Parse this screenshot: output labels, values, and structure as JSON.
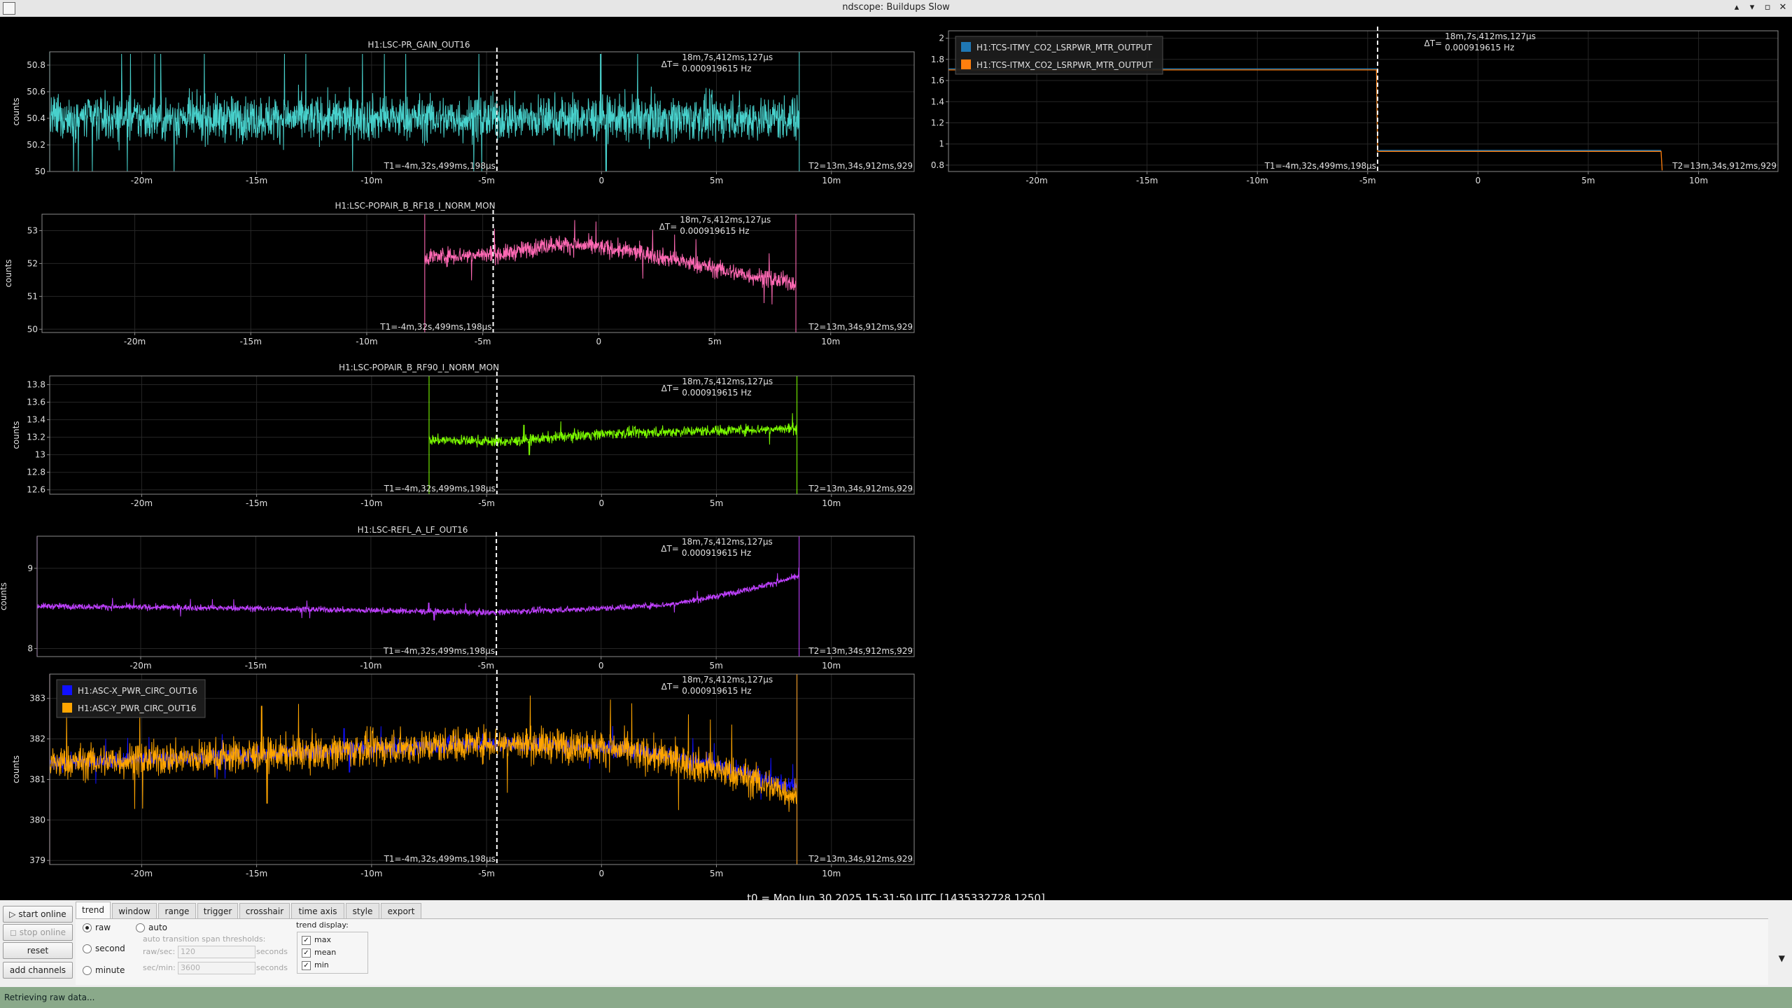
{
  "window": {
    "title": "ndscope: Buildups Slow",
    "minimize": "▴",
    "restore": "▾",
    "maximize": "▫",
    "close": "✕"
  },
  "colors": {
    "background": "#000000",
    "frame": "#8a8a8a",
    "grid": "#262626",
    "cursor": "#ffffff"
  },
  "cursor_labels": {
    "delta_prefix": "ΔT=",
    "delta_time": "18m,7s,412ms,127µs",
    "delta_freq": "0.000919615 Hz",
    "t1": "T1=-4m,32s,499ms,198µs",
    "t2": "T2=13m,34s,912ms,929"
  },
  "plots": [
    {
      "id": "pr-gain",
      "title": "H1:LSC-PR_GAIN_OUT16",
      "ylabel": "counts",
      "yticks": [
        "50",
        "50.2",
        "50.4",
        "50.6",
        "50.8"
      ],
      "xticks": [
        "-20m",
        "-15m",
        "-10m",
        "-5m",
        "0",
        "5m",
        "10m"
      ],
      "series": [
        {
          "name": "H1:LSC-PR_GAIN_OUT16",
          "color": "#48d1cc"
        }
      ],
      "chart_data": {
        "type": "line",
        "x_range_min": [
          -24,
          13.6
        ],
        "ylim": [
          50,
          50.9
        ],
        "series": [
          {
            "shape": "noise",
            "data_x": [
              -24,
              8.6
            ],
            "mean": [
              50.4,
              50.4
            ],
            "amp": 0.22
          }
        ]
      }
    },
    {
      "id": "rf18",
      "title": "H1:LSC-POPAIR_B_RF18_I_NORM_MON",
      "ylabel": "counts",
      "yticks": [
        "50",
        "51",
        "52",
        "53"
      ],
      "xticks": [
        "-20m",
        "-15m",
        "-10m",
        "-5m",
        "0",
        "5m",
        "10m"
      ],
      "series": [
        {
          "name": "H1:LSC-POPAIR_B_RF18_I_NORM_MON",
          "color": "#ff69b4"
        }
      ],
      "chart_data": {
        "type": "line",
        "x_range_min": [
          -24,
          13.6
        ],
        "ylim": [
          49.9,
          53.5
        ],
        "series": [
          {
            "shape": "trend",
            "data_x": [
              -7.5,
              8.5
            ],
            "points": [
              [
                -7.5,
                52.2
              ],
              [
                -4,
                52.3
              ],
              [
                -2,
                52.6
              ],
              [
                0,
                52.5
              ],
              [
                2,
                52.3
              ],
              [
                4,
                52.0
              ],
              [
                6,
                51.7
              ],
              [
                8.5,
                51.4
              ]
            ],
            "amp": 0.35
          }
        ]
      }
    },
    {
      "id": "rf90",
      "title": "H1:LSC-POPAIR_B_RF90_I_NORM_MON",
      "ylabel": "counts",
      "yticks": [
        "12.6",
        "12.8",
        "13",
        "13.2",
        "13.4",
        "13.6",
        "13.8"
      ],
      "xticks": [
        "-20m",
        "-15m",
        "-10m",
        "-5m",
        "0",
        "5m",
        "10m"
      ],
      "series": [
        {
          "name": "H1:LSC-POPAIR_B_RF90_I_NORM_MON",
          "color": "#7cfc00"
        }
      ],
      "chart_data": {
        "type": "line",
        "x_range_min": [
          -24,
          13.6
        ],
        "ylim": [
          12.55,
          13.9
        ],
        "series": [
          {
            "shape": "trend",
            "data_x": [
              -7.5,
              8.5
            ],
            "points": [
              [
                -7.5,
                13.17
              ],
              [
                -4,
                13.15
              ],
              [
                -2,
                13.2
              ],
              [
                0,
                13.24
              ],
              [
                4,
                13.27
              ],
              [
                8.5,
                13.3
              ]
            ],
            "amp": 0.08
          }
        ]
      }
    },
    {
      "id": "refl",
      "title": "H1:LSC-REFL_A_LF_OUT16",
      "ylabel": "counts",
      "yticks": [
        "8",
        "9"
      ],
      "xticks": [
        "-20m",
        "-15m",
        "-10m",
        "-5m",
        "0",
        "5m",
        "10m"
      ],
      "series": [
        {
          "name": "H1:LSC-REFL_A_LF_OUT16",
          "color": "#bf40ff"
        }
      ],
      "chart_data": {
        "type": "line",
        "x_range_min": [
          -24.5,
          13.6
        ],
        "ylim": [
          7.9,
          9.4
        ],
        "series": [
          {
            "shape": "trend",
            "data_x": [
              -24.5,
              8.6
            ],
            "points": [
              [
                -24.5,
                8.53
              ],
              [
                -15,
                8.5
              ],
              [
                -5,
                8.45
              ],
              [
                0,
                8.5
              ],
              [
                3,
                8.55
              ],
              [
                5,
                8.65
              ],
              [
                7,
                8.78
              ],
              [
                8.6,
                8.9
              ]
            ],
            "amp": 0.05
          }
        ]
      }
    },
    {
      "id": "asc-pwr",
      "title": "",
      "ylabel": "counts",
      "yticks": [
        "379",
        "380",
        "381",
        "382",
        "383"
      ],
      "xticks": [
        "-20m",
        "-15m",
        "-10m",
        "-5m",
        "0",
        "5m",
        "10m"
      ],
      "series": [
        {
          "name": "H1:ASC-X_PWR_CIRC_OUT16",
          "color": "#1010ff"
        },
        {
          "name": "H1:ASC-Y_PWR_CIRC_OUT16",
          "color": "#ffa500"
        }
      ],
      "chart_data": {
        "type": "line",
        "x_range_min": [
          -24,
          13.6
        ],
        "ylim": [
          378.9,
          383.6
        ],
        "series": [
          {
            "shape": "trend",
            "data_x": [
              -24,
              8.5
            ],
            "points": [
              [
                -24,
                381.4
              ],
              [
                -15,
                381.6
              ],
              [
                -5,
                381.9
              ],
              [
                0,
                381.8
              ],
              [
                3,
                381.6
              ],
              [
                6,
                381.2
              ],
              [
                8.5,
                380.8
              ]
            ],
            "amp": 0.25
          },
          {
            "shape": "trend",
            "data_x": [
              -24,
              8.5
            ],
            "points": [
              [
                -24,
                381.4
              ],
              [
                -15,
                381.6
              ],
              [
                -5,
                381.9
              ],
              [
                0,
                381.8
              ],
              [
                3,
                381.5
              ],
              [
                6,
                381.1
              ],
              [
                8.5,
                380.6
              ]
            ],
            "amp": 0.55
          }
        ]
      }
    },
    {
      "id": "tcs",
      "title": "",
      "ylabel": "",
      "yticks": [
        "0.8",
        "1",
        "1.2",
        "1.4",
        "1.6",
        "1.8",
        "2"
      ],
      "xticks": [
        "-20m",
        "-15m",
        "-10m",
        "-5m",
        "0",
        "5m",
        "10m"
      ],
      "series": [
        {
          "name": "H1:TCS-ITMY_CO2_LSRPWR_MTR_OUTPUT",
          "color": "#1f77b4"
        },
        {
          "name": "H1:TCS-ITMX_CO2_LSRPWR_MTR_OUTPUT",
          "color": "#ff7f0e"
        }
      ],
      "chart_data": {
        "type": "line",
        "x_range_min": [
          -24,
          13.6
        ],
        "ylim": [
          0.74,
          2.07
        ],
        "series": [
          {
            "shape": "step",
            "points": [
              [
                -24,
                1.71
              ],
              [
                -4.6,
                1.71
              ],
              [
                -4.55,
                0.94
              ],
              [
                8.3,
                0.94
              ]
            ]
          },
          {
            "shape": "step",
            "points": [
              [
                -24,
                1.7
              ],
              [
                -4.6,
                1.7
              ],
              [
                -4.55,
                0.93
              ],
              [
                8.3,
                0.93
              ],
              [
                8.35,
                0.75
              ]
            ]
          }
        ]
      }
    }
  ],
  "t0_label": "t0 = Mon Jun 30 2025 15:31:50 UTC [1435332728.1250]",
  "controls": {
    "buttons": {
      "start_online": "▷ start online",
      "stop_online": "◻ stop online",
      "reset": "reset",
      "add_channels": "add channels"
    },
    "tabs": [
      "trend",
      "window",
      "range",
      "trigger",
      "crosshair",
      "time axis",
      "style",
      "export"
    ],
    "trend": {
      "raw": "raw",
      "auto": "auto",
      "second": "second",
      "minute": "minute",
      "auto_title": "auto transition span thresholds:",
      "raw_sec_label": "raw/sec:",
      "raw_sec_value": "120",
      "seconds1": "seconds",
      "sec_min_label": "sec/min:",
      "sec_min_value": "3600",
      "seconds2": "seconds",
      "trend_display": "trend display:",
      "max": "max",
      "mean": "mean",
      "min": "min"
    },
    "expand_arrow": "▼"
  },
  "status": "Retrieving raw data..."
}
